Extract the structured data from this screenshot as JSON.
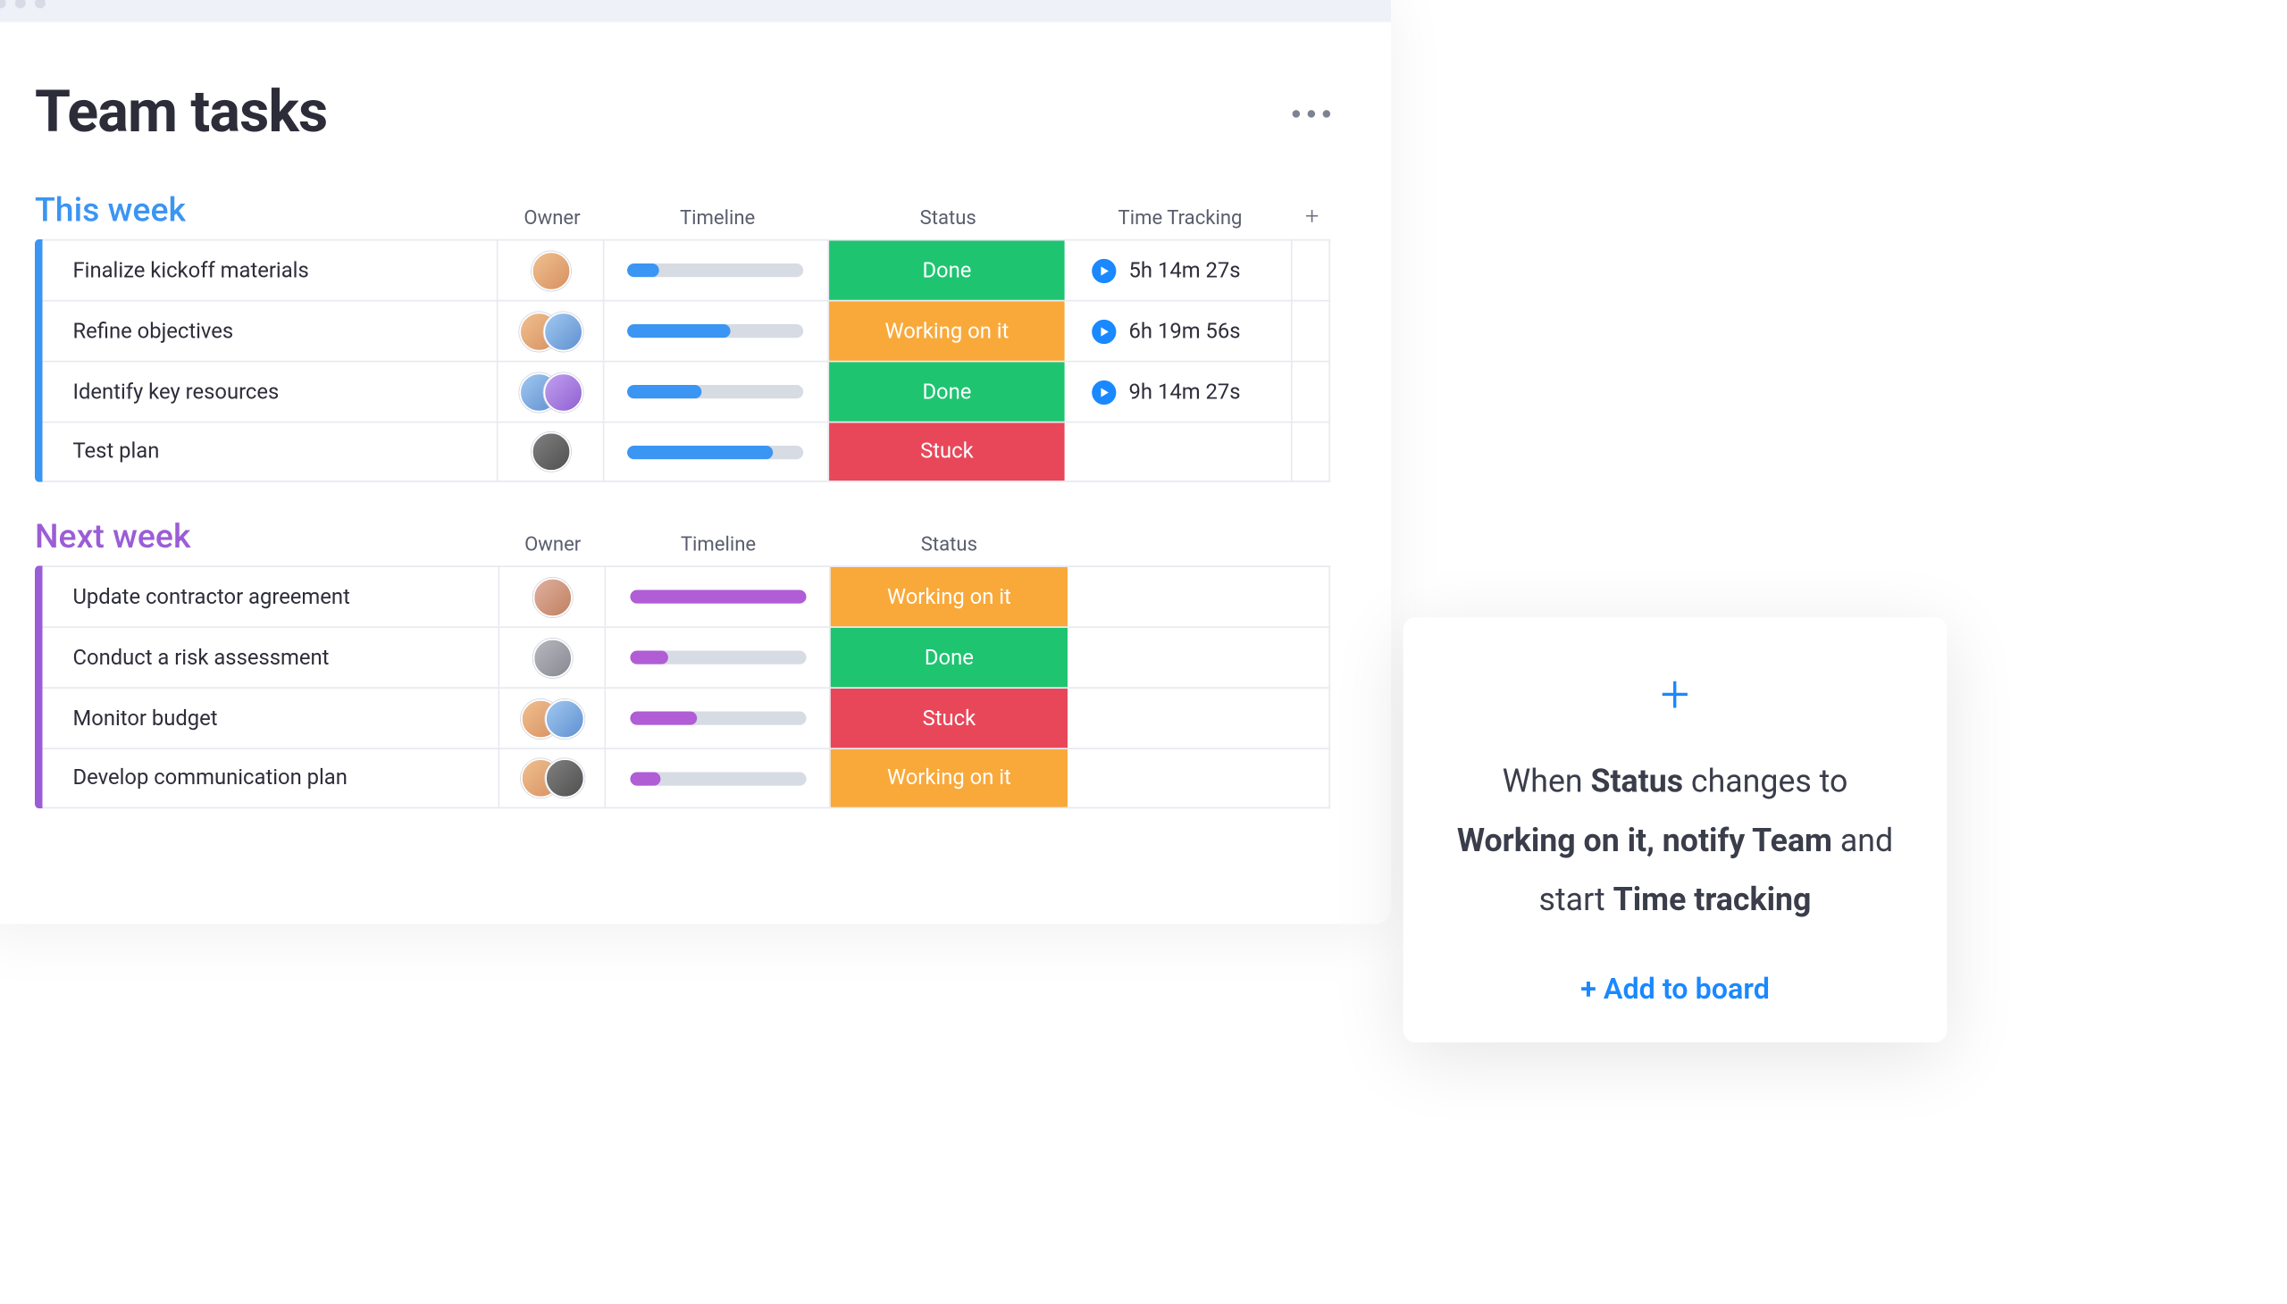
{
  "title": "Team tasks",
  "columns": {
    "owner": "Owner",
    "timeline": "Timeline",
    "status": "Status",
    "time_tracking": "Time Tracking"
  },
  "groups": [
    {
      "name": "This week",
      "color": "blue",
      "rows": [
        {
          "name": "Finalize kickoff materials",
          "owners": [
            "a1"
          ],
          "progress": 18,
          "status": "Done",
          "status_class": "done",
          "time": "5h 14m 27s"
        },
        {
          "name": "Refine objectives",
          "owners": [
            "a1",
            "a2"
          ],
          "progress": 58,
          "status": "Working on it",
          "status_class": "working",
          "time": "6h 19m 56s"
        },
        {
          "name": "Identify key resources",
          "owners": [
            "a2",
            "a3"
          ],
          "progress": 42,
          "status": "Done",
          "status_class": "done",
          "time": "9h 14m 27s"
        },
        {
          "name": "Test plan",
          "owners": [
            "a4"
          ],
          "progress": 82,
          "status": "Stuck",
          "status_class": "stuck",
          "time": ""
        }
      ]
    },
    {
      "name": "Next week",
      "color": "purple",
      "rows": [
        {
          "name": "Update contractor agreement",
          "owners": [
            "a5"
          ],
          "progress": 100,
          "status": "Working on it",
          "status_class": "working",
          "time": ""
        },
        {
          "name": "Conduct a risk assessment",
          "owners": [
            "a6"
          ],
          "progress": 22,
          "status": "Done",
          "status_class": "done",
          "time": ""
        },
        {
          "name": "Monitor budget",
          "owners": [
            "a1",
            "a2"
          ],
          "progress": 38,
          "status": "Stuck",
          "status_class": "stuck",
          "time": ""
        },
        {
          "name": "Develop communication plan",
          "owners": [
            "a1",
            "a4"
          ],
          "progress": 18,
          "status": "Working on it",
          "status_class": "working",
          "time": ""
        }
      ]
    }
  ],
  "automation": {
    "text_parts": [
      "When ",
      "Status",
      " changes to ",
      "Working on it, notify Team",
      " and start ",
      "Time tracking"
    ],
    "action": "+ Add to board"
  }
}
